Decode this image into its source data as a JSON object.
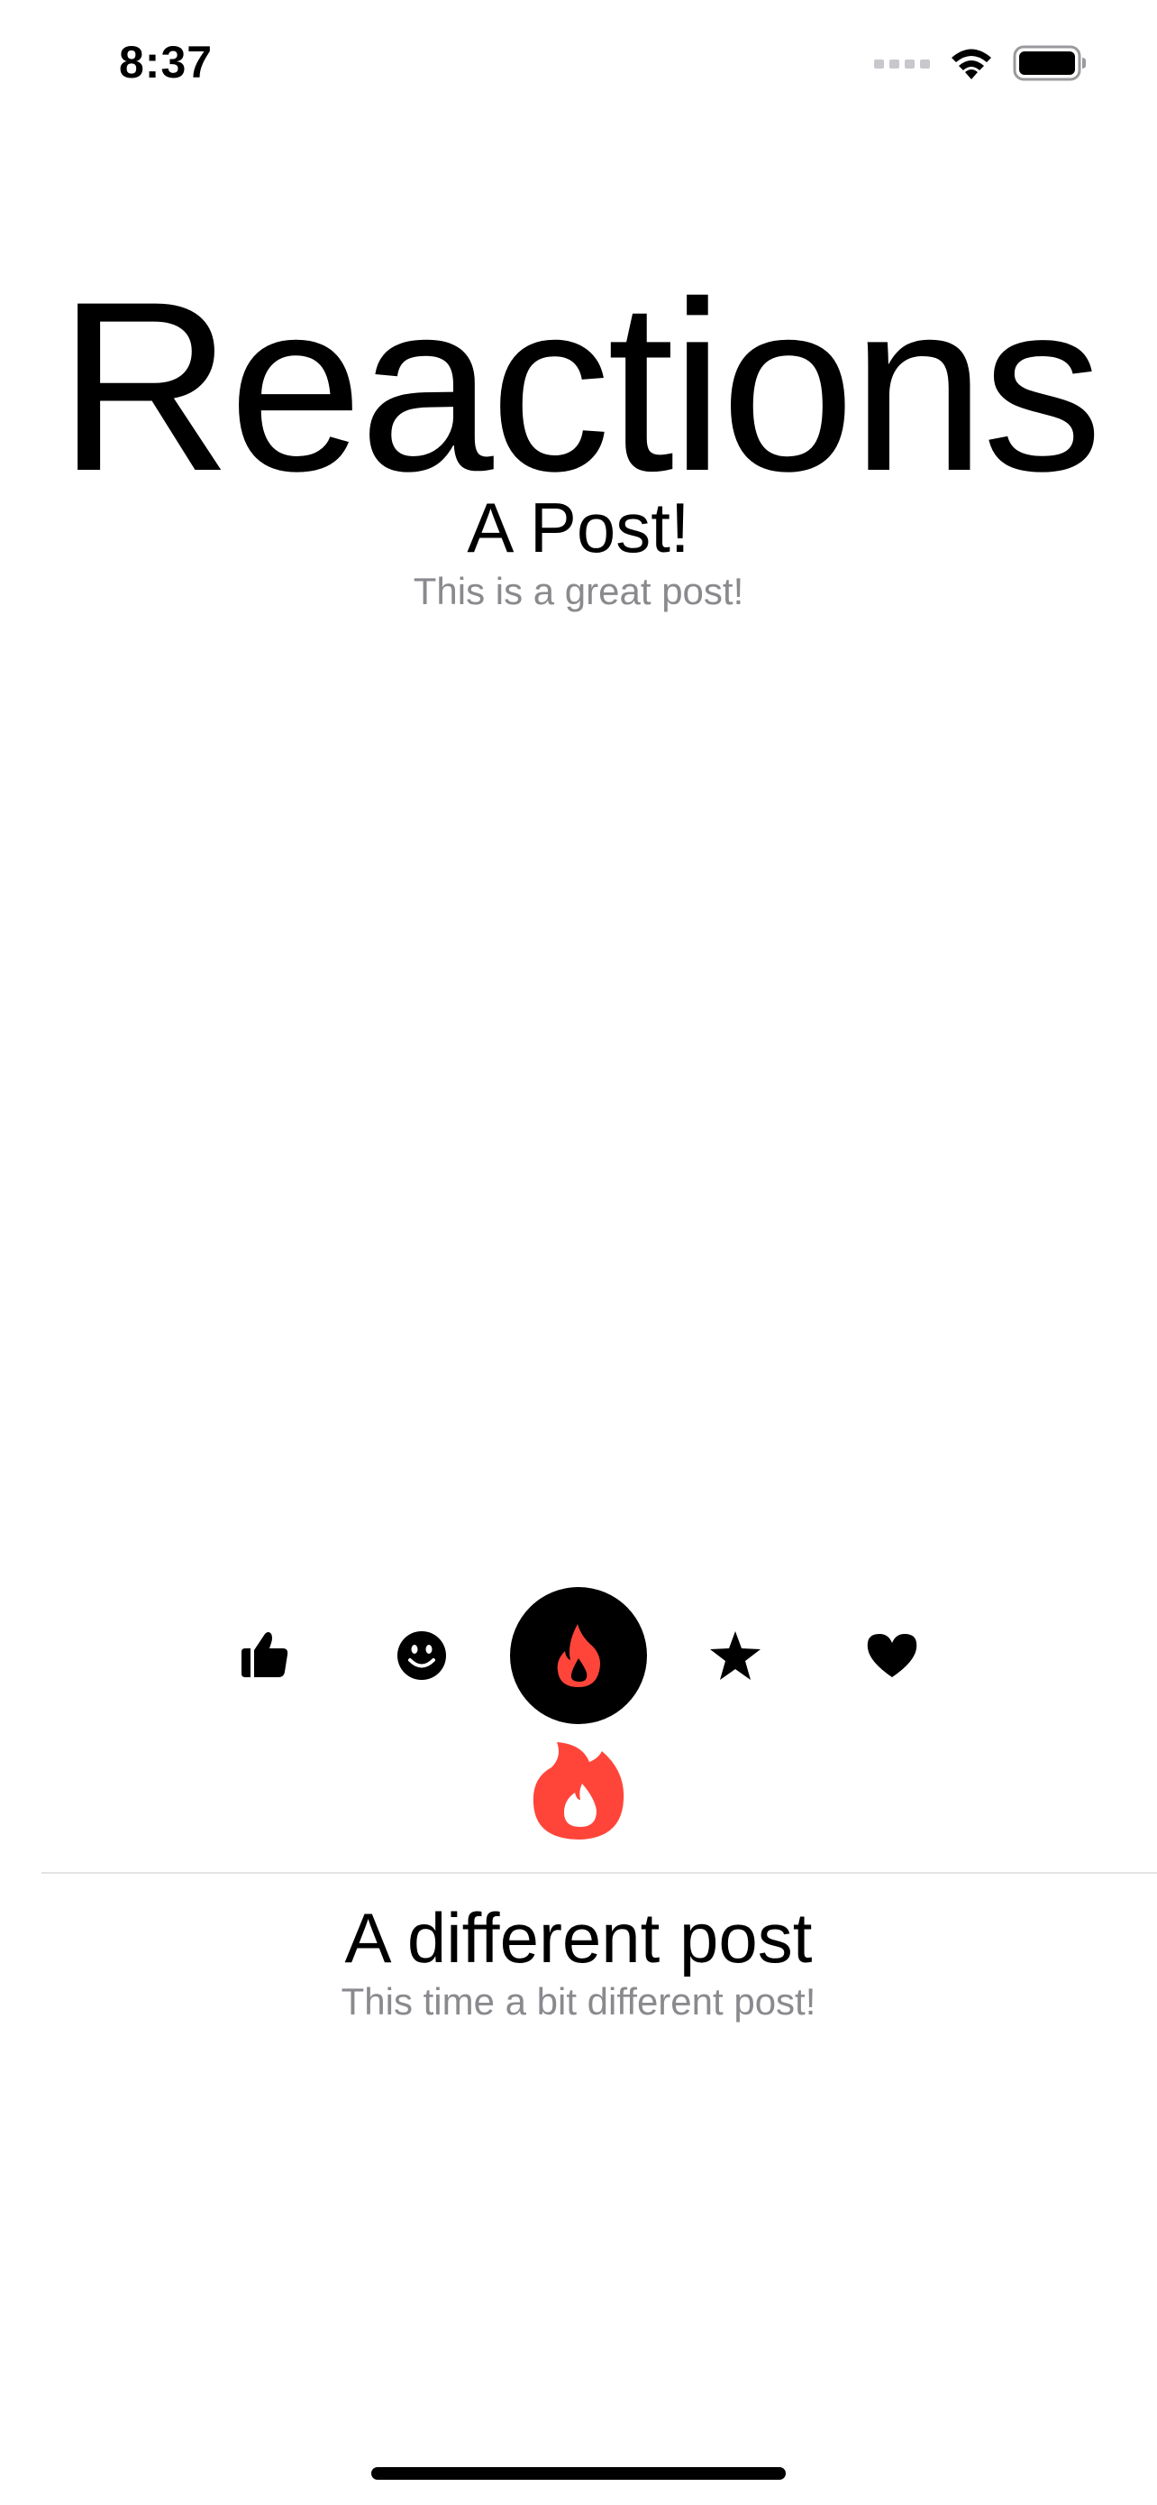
{
  "status_bar": {
    "time": "8:37",
    "icons": [
      "cellular-signal-icon",
      "wifi-icon",
      "battery-icon"
    ]
  },
  "app": {
    "title": "Reactions"
  },
  "posts": [
    {
      "title": "A Post!",
      "subtitle": "This is a great post!",
      "reactions": [
        {
          "icon": "thumbs-up-icon",
          "selected": false
        },
        {
          "icon": "smiley-face-icon",
          "selected": false
        },
        {
          "icon": "flame-icon",
          "selected": true
        },
        {
          "icon": "star-icon",
          "selected": false
        },
        {
          "icon": "heart-icon",
          "selected": false
        }
      ],
      "selected_reaction": "flame-icon"
    },
    {
      "title": "A different post",
      "subtitle": "This time a bit different post!"
    }
  ],
  "colors": {
    "accent_flame": "#ff453a",
    "selected_background": "#000000",
    "subtitle_gray": "#8a8a8e",
    "divider": "#e3e3e6"
  }
}
